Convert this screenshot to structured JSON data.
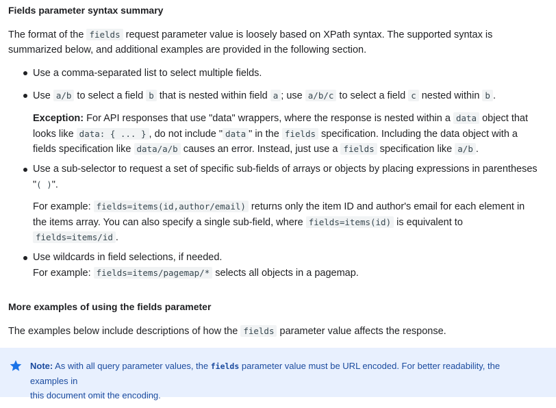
{
  "section1": {
    "heading": "Fields parameter syntax summary",
    "intro": {
      "p1_before": "The format of the ",
      "p1_code": "fields",
      "p1_after": " request parameter value is loosely based on XPath syntax. The supported syntax is",
      "p2": "summarized below, and additional examples are provided in the following section."
    },
    "bullets": {
      "b1": "Use a comma-separated list to select multiple fields.",
      "b2": {
        "t1": "Use ",
        "c1": "a/b",
        "t2": " to select a field ",
        "c2": "b",
        "t3": " that is nested within field ",
        "c3": "a",
        "t4": "; use ",
        "c4": "a/b/c",
        "t5": " to select a field ",
        "c5": "c",
        "t6": " nested within ",
        "c6": "b",
        "t7": "."
      },
      "exception": {
        "label": "Exception:",
        "l1_a": " For API responses that use \"data\" wrappers, where the response is nested within a ",
        "l1_code": "data",
        "l1_b": " object that",
        "l2_a": "looks like ",
        "l2_code1": "data: { ... }",
        "l2_b": ", do not include \"",
        "l2_code2": "data",
        "l2_c": "\" in the ",
        "l2_code3": "fields",
        "l2_d": " specification. Including the data object with a",
        "l3_a": "fields specification like ",
        "l3_code1": "data/a/b",
        "l3_b": " causes an error. Instead, just use a ",
        "l3_code2": "fields",
        "l3_c": " specification like ",
        "l3_code3": "a/b",
        "l3_d": "."
      },
      "b3": {
        "line1": "Use a sub-selector to request a set of specific sub-fields of arrays or objects by placing expressions in parentheses",
        "line2_a": "\"",
        "line2_code": "( )",
        "line2_b": "\"."
      },
      "example1": {
        "l1_a": "For example: ",
        "l1_code": "fields=items(id,author/email)",
        "l1_b": " returns only the item ID and author's email for each element in",
        "l2_a": "the items array. You can also specify a single sub-field, where ",
        "l2_code": "fields=items(id)",
        "l2_b": " is equivalent to",
        "l3_code": "fields=items/id",
        "l3_b": "."
      },
      "b4": {
        "line1": "Use wildcards in field selections, if needed.",
        "line2_a": "For example: ",
        "line2_code": "fields=items/pagemap/*",
        "line2_b": " selects all objects in a pagemap."
      }
    }
  },
  "section2": {
    "heading": "More examples of using the fields parameter",
    "p_a": "The examples below include descriptions of how the ",
    "p_code": "fields",
    "p_b": " parameter value affects the response."
  },
  "note": {
    "icon": "star-icon",
    "label": "Note:",
    "l1_a": " As with all query parameter values, the ",
    "l1_code": "fields",
    "l1_b": " parameter value must be URL encoded. For better readability, the examples in",
    "l2": "this document omit the encoding.",
    "color": "#1a73e8",
    "bg": "#e8f0fe"
  }
}
